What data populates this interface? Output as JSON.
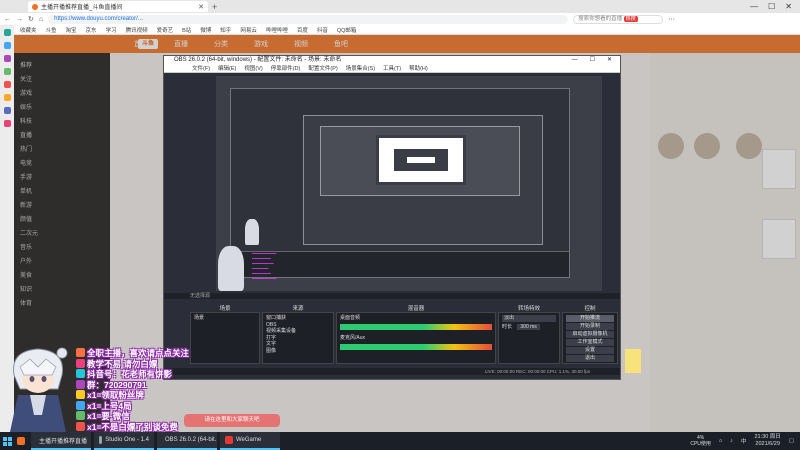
{
  "browser": {
    "tab_title": "主播开播推荐直播_斗鱼直播间",
    "url": "https://www.douyu.com/creator/...",
    "search_placeholder": "搜索你想看的直播",
    "search_badge": "热搜",
    "bookmarks": [
      "收藏夹",
      "斗鱼",
      "淘宝",
      "京东",
      "学习",
      "腾讯视频",
      "爱奇艺",
      "B站",
      "微博",
      "知乎",
      "网易云",
      "哔哩哔哩",
      "百度",
      "抖音",
      "QQ邮箱"
    ]
  },
  "douyu": {
    "nav_items": [
      "首页",
      "直播",
      "分类",
      "游戏",
      "视频",
      "鱼吧"
    ],
    "sidebar_items": [
      "推荐",
      "关注",
      "游戏",
      "娱乐",
      "科技",
      "直播",
      "热门",
      "电竞",
      "手游",
      "单机",
      "新游",
      "颜值",
      "二次元",
      "音乐",
      "户外",
      "美食",
      "知识",
      "体育"
    ]
  },
  "obs": {
    "title": "OBS 26.0.2 (64-bit, windows) - 配置文件: 未命名 - 场景: 未命名",
    "menu": [
      "文件(F)",
      "编辑(E)",
      "视图(V)",
      "停靠部件(D)",
      "配置文件(P)",
      "场景集合(S)",
      "工具(T)",
      "帮助(H)"
    ],
    "status_text": "无选择源",
    "scene_panel": "场景",
    "sources_panel": "来源",
    "mixer_panel": "混音器",
    "transitions_panel": "转场特效",
    "controls_panel": "控制",
    "scenes": [
      "场景"
    ],
    "sources": [
      "窗口捕获",
      "OBS",
      "视频采集设备",
      "打字",
      "文字",
      "图像"
    ],
    "mixer_tracks": [
      "桌面音频",
      "麦克风/Aux"
    ],
    "transition": "淡出",
    "duration_label": "时长",
    "duration_value": "300 ms",
    "controls": [
      "开始推流",
      "开始录制",
      "启动虚拟摄像机",
      "工作室模式",
      "设置",
      "退出"
    ],
    "bottom_status": "LIVE: 00:00:00  REC: 00:00:00  CPU: 1.1%, 30.00 fps"
  },
  "overlay": {
    "lines": [
      "全职主播，喜欢请点点关注",
      "教学不易 请勿白嫖",
      "抖音号：花老师有饼影",
      "群：720290791",
      "x1=领取粉丝牌",
      "x1=上号4局",
      "x1=要·微信",
      "x1=不是白嫖了别谈免费",
      "粉丝牌8级进入V群"
    ],
    "hint": "请在这里和大家聊天吧"
  },
  "taskbar": {
    "apps": [
      "主播开播推荐直播",
      "Studio One - 1.4",
      "OBS 26.0.2 (64-bit...",
      "WeGame"
    ],
    "tray_temp": "4%",
    "tray_cpu_label": "CPU使用",
    "time": "21:30 周日",
    "date": "2021/6/29"
  },
  "colors": {
    "douyu_orange": "#f5833b",
    "obs_dark": "#2b2e38",
    "overlay_outline": "#8e24aa"
  }
}
